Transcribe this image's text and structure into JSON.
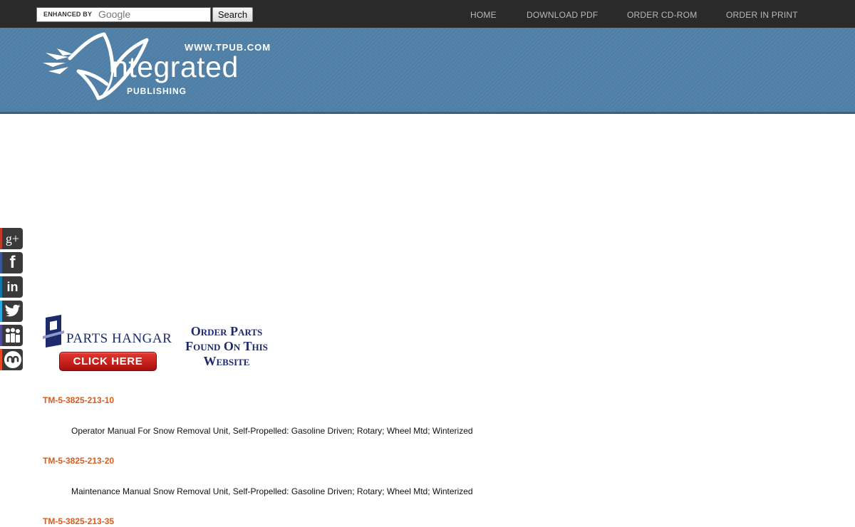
{
  "search": {
    "enhanced_label": "ENHANCED BY",
    "google_label": "Google",
    "button_label": "Search",
    "value": ""
  },
  "nav": {
    "items": [
      {
        "label": "HOME"
      },
      {
        "label": "DOWNLOAD PDF"
      },
      {
        "label": "ORDER CD-ROM"
      },
      {
        "label": "ORDER IN PRINT"
      }
    ]
  },
  "logo": {
    "url": "WWW.TPUB.COM",
    "name": "ntegrated",
    "sub": "PUBLISHING"
  },
  "social": {
    "items": [
      {
        "icon": "google-plus-icon",
        "glyph": "g+"
      },
      {
        "icon": "facebook-icon",
        "glyph": "f"
      },
      {
        "icon": "linkedin-icon",
        "glyph": "in"
      },
      {
        "icon": "twitter-icon",
        "glyph": ""
      },
      {
        "icon": "myspace-icon",
        "glyph": ""
      },
      {
        "icon": "stumbleupon-icon",
        "glyph": ""
      }
    ]
  },
  "ad": {
    "name": "PARTS HANGAR",
    "button": "CLICK HERE",
    "line1": "Order Parts",
    "line2": "Found On This",
    "line3": "Website"
  },
  "manuals": [
    {
      "code": "TM-5-3825-213-10",
      "description": "Operator Manual For Snow Removal Unit, Self-Propelled: Gasoline Driven; Rotary; Wheel Mtd; Winterized"
    },
    {
      "code": "TM-5-3825-213-20",
      "description": "Maintenance Manual Snow Removal Unit, Self-Propelled: Gasoline Driven; Rotary; Wheel Mtd; Winterized"
    },
    {
      "code": "TM-5-3825-213-35",
      "description": ""
    }
  ],
  "colors": {
    "topbar": "#2a2a2a",
    "banner": "#4f7fa6",
    "link": "#d95c1d",
    "ad_text": "#1d2a6b"
  }
}
